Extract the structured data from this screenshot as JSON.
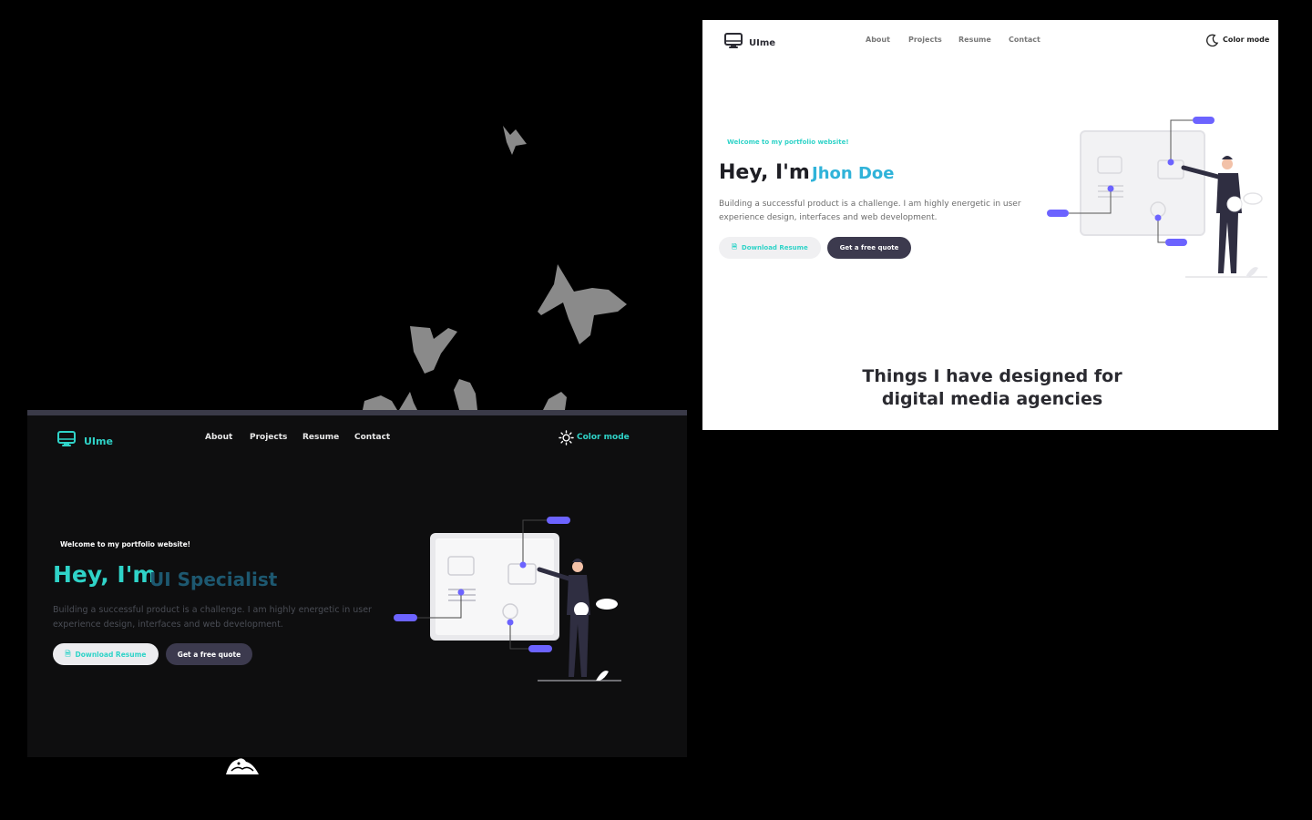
{
  "dark_screen": {
    "logo": {
      "text": "UIme",
      "icon": "monitor-icon"
    },
    "nav": {
      "about": "About",
      "projects": "Projects",
      "resume": "Resume",
      "contact": "Contact"
    },
    "color_mode": {
      "label": "Color mode",
      "icon": "sun-icon"
    },
    "hero": {
      "welcome": "Welcome to my portfolio website!",
      "greeting": "Hey, I'm",
      "role": "UI Specialist",
      "description": "Building a successful product is a challenge. I am highly energetic in user experience design, interfaces and web development.",
      "download_button": "Download Resume",
      "quote_button": "Get a free quote"
    }
  },
  "light_screen": {
    "logo": {
      "text": "UIme",
      "icon": "monitor-icon"
    },
    "nav": {
      "about": "About",
      "projects": "Projects",
      "resume": "Resume",
      "contact": "Contact"
    },
    "color_mode": {
      "label": "Color mode",
      "icon": "moon-icon"
    },
    "hero": {
      "welcome": "Welcome to my portfolio website!",
      "greeting": "Hey, I'm",
      "name": "Jhon Doe",
      "description": "Building a successful product is a challenge. I am highly energetic in user experience design, interfaces and web development.",
      "download_button": "Download Resume",
      "quote_button": "Get a free quote"
    },
    "section_heading": "Things I have designed for digital media agencies"
  },
  "colors": {
    "accent": "#2fd3c8",
    "role_blue": "#1d5870",
    "name_blue": "#30b3d9",
    "button_dark": "#3c3a4e",
    "illustration_purple": "#6c63ff"
  }
}
